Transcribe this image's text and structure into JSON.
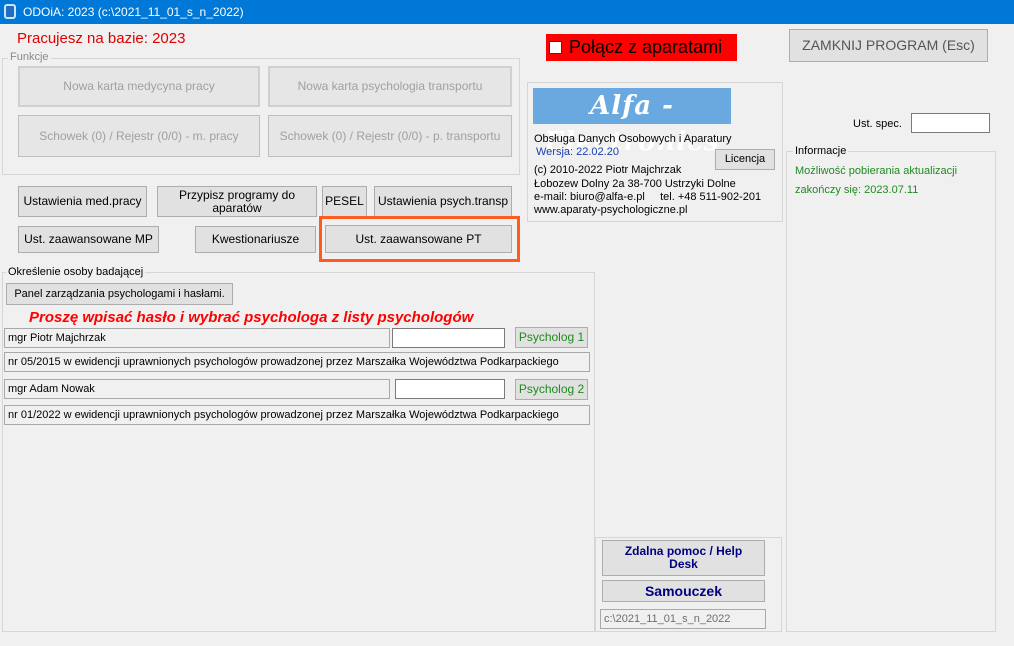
{
  "window": {
    "title": "ODOiA: 2023 (c:\\2021_11_01_s_n_2022)"
  },
  "base_label": "Pracujesz na bazie: 2023",
  "connect": {
    "label": "Połącz z aparatami",
    "checked": false
  },
  "close_button": "ZAMKNIJ PROGRAM (Esc)",
  "funkcje": {
    "legend": "Funkcje",
    "new_med": "Nowa karta medycyna pracy",
    "new_psych": "Nowa karta psychologia transportu",
    "clip_med": "Schowek (0) / Rejestr (0/0)  - m. pracy",
    "clip_psych": "Schowek (0) / Rejestr (0/0)  - p. transportu"
  },
  "alfa": {
    "logo": "Alfa - Electronics",
    "service": "Obsługa Danych Osobowych i Aparatury",
    "version": "Wersja: 22.02.20",
    "license_button": "Licencja",
    "copyright": "(c) 2010-2022 Piotr Majchrzak",
    "address": "Łobozew Dolny 2a  38-700 Ustrzyki Dolne",
    "contact": "e-mail: biuro@alfa-e.pl     tel. +48 511-902-201",
    "website": "www.aparaty-psychologiczne.pl"
  },
  "ust_spec": {
    "label": "Ust. spec.",
    "value": ""
  },
  "info": {
    "legend": "Informacje",
    "line1": "Możliwość pobierania aktualizacji",
    "line2": "zakończy się: 2023.07.11"
  },
  "toolbar": {
    "ust_med": "Ustawienia med.pracy",
    "przypisz": "Przypisz programy do aparatów",
    "pesel": "PESEL",
    "ust_psych": "Ustawienia psych.transp",
    "ust_zaaw_mp": "Ust. zaawansowane MP",
    "kwest": "Kwestionariusze",
    "ust_zaaw_pt": "Ust.  zaawansowane PT"
  },
  "osoba": {
    "legend": "Określenie osoby badającej",
    "panel_button": "Panel zarządzania psychologami i hasłami.",
    "prompt": "Proszę wpisać hasło i wybrać psychologa z listy psychologów",
    "psych1": {
      "name": "mgr Piotr Majchrzak",
      "password": "",
      "button": "Psycholog 1",
      "record": "nr 05/2015 w ewidencji uprawnionych psychologów prowadzonej przez Marszałka Województwa Podkarpackiego"
    },
    "psych2": {
      "name": "mgr Adam Nowak",
      "password": "",
      "button": "Psycholog 2",
      "record": "nr 01/2022 w ewidencji uprawnionych psychologów prowadzonej przez Marszałka Województwa Podkarpackiego"
    }
  },
  "help": {
    "remote": "Zdalna pomoc / Help Desk",
    "samouczek": "Samouczek",
    "path": "c:\\2021_11_01_s_n_2022"
  },
  "colors": {
    "titlebar": "#0078d7",
    "accent_red": "#ff0000",
    "highlight_box": "#ff5a1f",
    "logo_bg": "#6aa9e0",
    "info_green": "#1f8a1f",
    "version_blue": "#1a3fb0",
    "help_blue": "#000080"
  }
}
